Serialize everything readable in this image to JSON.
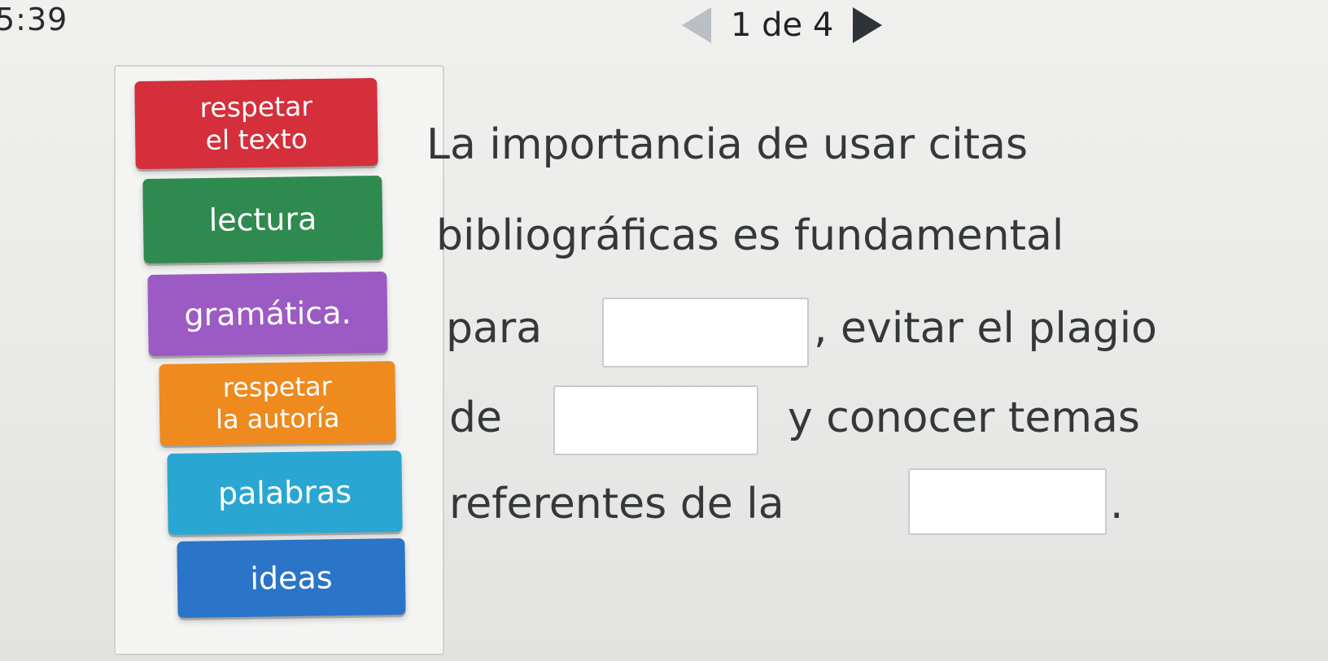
{
  "status": {
    "timer": "5:39"
  },
  "pager": {
    "text": "1 de 4"
  },
  "word_bank": [
    {
      "label": "respetar\nel texto",
      "color": "#d42f3a"
    },
    {
      "label": "lectura",
      "color": "#2f8a4f"
    },
    {
      "label": "gramática.",
      "color": "#9c5ac4"
    },
    {
      "label": "respetar\nla autoría",
      "color": "#ee8a1e"
    },
    {
      "label": "palabras",
      "color": "#2aa6d2"
    },
    {
      "label": "ideas",
      "color": "#2a74c9"
    }
  ],
  "sentence": {
    "line1": "La importancia de usar citas",
    "line2": "bibliográficas es fundamental",
    "line3_before": "para",
    "line3_after": ", evitar el plagio",
    "line4_before": "de",
    "line4_after": "y conocer temas",
    "line5_before": "referentes de la",
    "line5_after": "."
  }
}
